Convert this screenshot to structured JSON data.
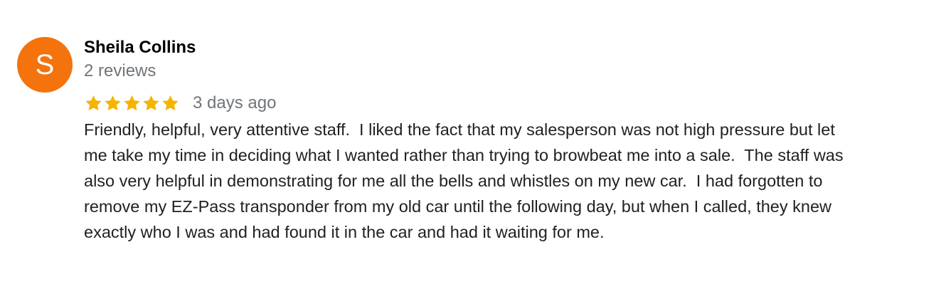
{
  "review": {
    "avatar_letter": "S",
    "avatar_color": "#f4730d",
    "reviewer_name": "Sheila Collins",
    "review_count": "2 reviews",
    "rating": 5,
    "rating_max": 5,
    "star_color": "#f5b400",
    "date": "3 days ago",
    "text": "Friendly, helpful, very attentive staff.  I liked the fact that my salesperson was not high pressure but let me take my time in deciding what I wanted rather than trying to browbeat me into a sale.  The staff was also very helpful in demonstrating for me all the bells and whistles on my new car.  I had forgotten to remove my EZ-Pass transponder from my old car until the following day, but when I called, they knew exactly who I was and had found it in the car and had it waiting for me."
  }
}
